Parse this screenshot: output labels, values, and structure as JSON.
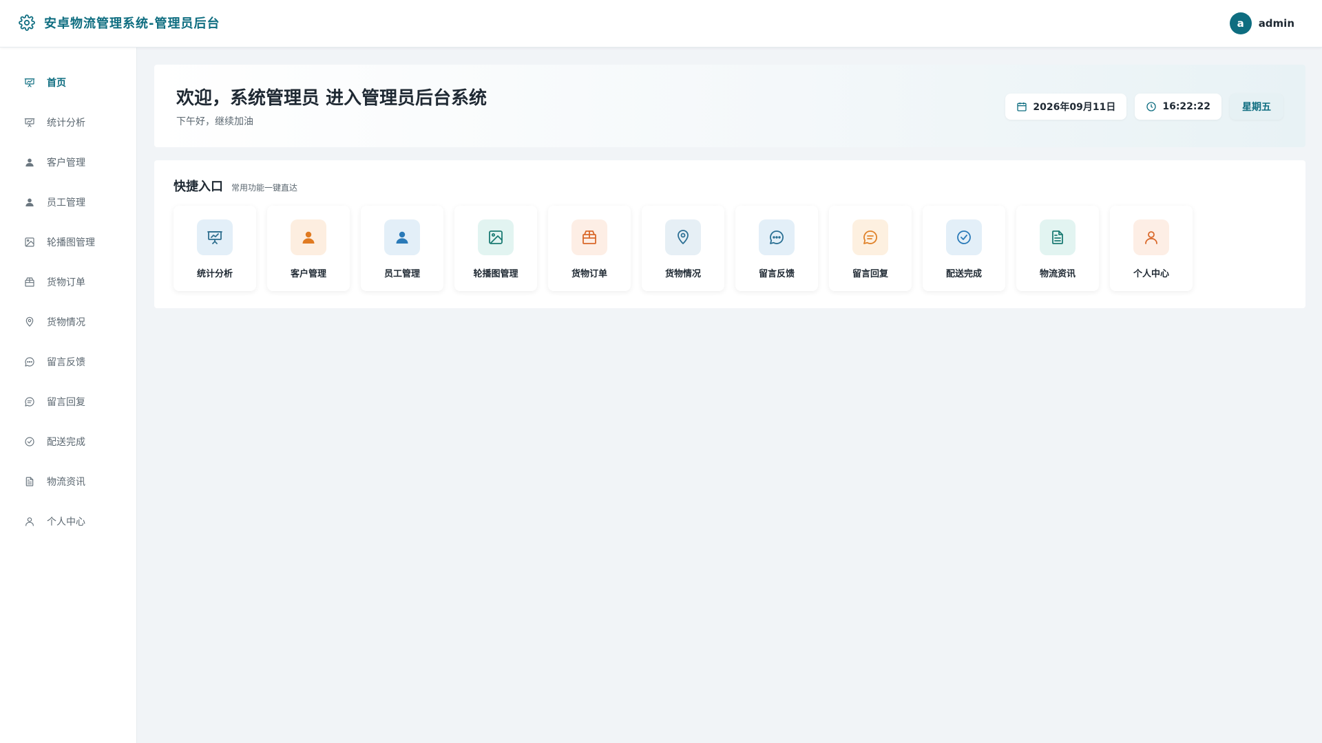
{
  "header": {
    "title": "安卓物流管理系统-管理员后台",
    "brand_icon": "gear-icon",
    "user": {
      "avatar_letter": "a",
      "name": "admin"
    }
  },
  "sidebar": {
    "items": [
      {
        "label": "首页",
        "icon": "presentation-icon",
        "active": true
      },
      {
        "label": "统计分析",
        "icon": "presentation-icon"
      },
      {
        "label": "客户管理",
        "icon": "user-icon"
      },
      {
        "label": "员工管理",
        "icon": "user-icon"
      },
      {
        "label": "轮播图管理",
        "icon": "image-icon"
      },
      {
        "label": "货物订单",
        "icon": "box-icon"
      },
      {
        "label": "货物情况",
        "icon": "location-pin-icon"
      },
      {
        "label": "留言反馈",
        "icon": "chat-dots-icon"
      },
      {
        "label": "留言回复",
        "icon": "chat-lines-icon"
      },
      {
        "label": "配送完成",
        "icon": "check-circle-icon"
      },
      {
        "label": "物流资讯",
        "icon": "document-icon"
      },
      {
        "label": "个人中心",
        "icon": "user-outline-icon"
      }
    ]
  },
  "welcome": {
    "title": "欢迎，系统管理员 进入管理员后台系统",
    "subtitle": "下午好，继续加油",
    "date": "2026年09月11日",
    "time": "16:22:22",
    "weekday": "星期五"
  },
  "quick": {
    "title": "快捷入口",
    "subtitle": "常用功能一键直达",
    "cards": [
      {
        "label": "统计分析",
        "icon": "presentation-icon",
        "color": "#2e6e8e",
        "bg": "#e3eff8"
      },
      {
        "label": "客户管理",
        "icon": "user-icon",
        "color": "#e07b22",
        "bg": "#fdeee0"
      },
      {
        "label": "员工管理",
        "icon": "user-icon",
        "color": "#2a7ab8",
        "bg": "#e3eff8"
      },
      {
        "label": "轮播图管理",
        "icon": "image-icon",
        "color": "#1b7b73",
        "bg": "#e2f4f1"
      },
      {
        "label": "货物订单",
        "icon": "box-icon",
        "color": "#d9682a",
        "bg": "#fdeee5"
      },
      {
        "label": "货物情况",
        "icon": "location-pin-icon",
        "color": "#2c6f94",
        "bg": "#e6eff5"
      },
      {
        "label": "留言反馈",
        "icon": "chat-dots-icon",
        "color": "#2a6f93",
        "bg": "#e3eff8"
      },
      {
        "label": "留言回复",
        "icon": "chat-lines-icon",
        "color": "#e0822a",
        "bg": "#fdf0e0"
      },
      {
        "label": "配送完成",
        "icon": "check-circle-icon",
        "color": "#2a7ab8",
        "bg": "#e3eff8"
      },
      {
        "label": "物流资讯",
        "icon": "document-icon",
        "color": "#1b7b73",
        "bg": "#e2f4f1"
      },
      {
        "label": "个人中心",
        "icon": "user-outline-icon",
        "color": "#d9682a",
        "bg": "#fdeee5"
      }
    ]
  },
  "colors": {
    "accent": "#0e6d80",
    "nav_text": "#5b6770"
  }
}
